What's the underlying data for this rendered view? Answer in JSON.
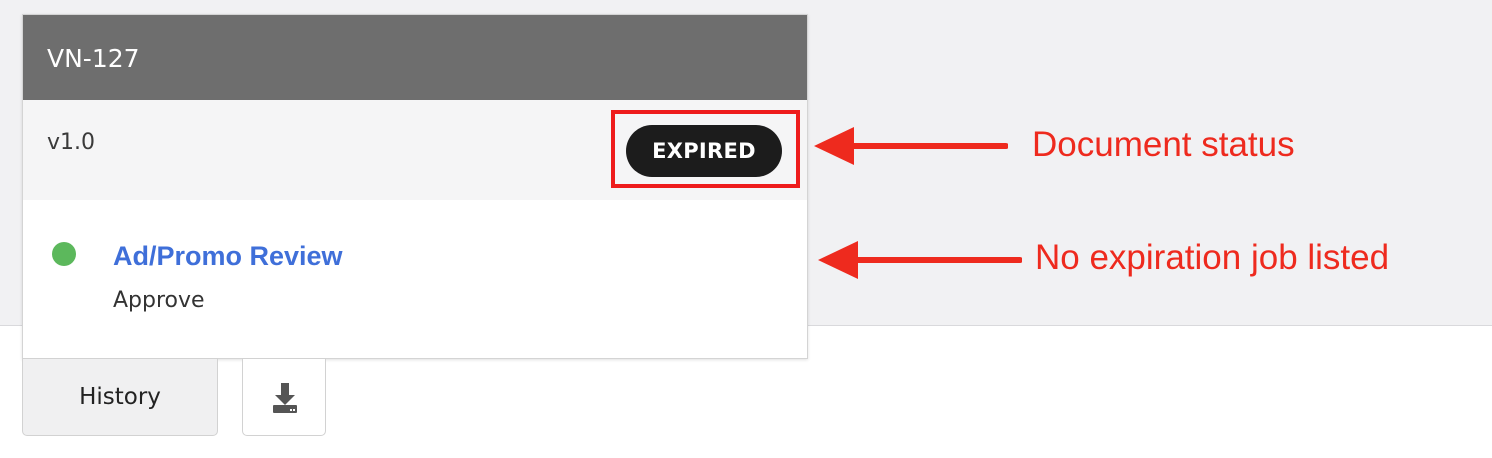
{
  "document": {
    "id": "VN-127",
    "version": "v1.0",
    "status": "EXPIRED"
  },
  "workflow": {
    "name": "Ad/Promo Review",
    "step": "Approve",
    "status_color": "#5cb85c"
  },
  "actions": {
    "history_label": "History",
    "download_icon": "download-icon"
  },
  "annotations": {
    "status_label": "Document status",
    "job_label": "No expiration job listed",
    "color": "#ee2a1e"
  }
}
